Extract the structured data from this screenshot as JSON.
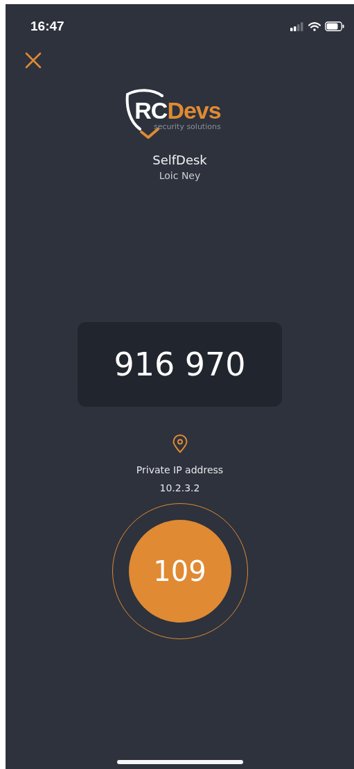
{
  "status_bar": {
    "time": "16:47"
  },
  "logo": {
    "wordmark_part_1": "RC",
    "wordmark_part_2": "Devs",
    "tagline": "security solutions"
  },
  "account": {
    "title": "SelfDesk",
    "user": "Loic Ney"
  },
  "otp": {
    "code": "916 970"
  },
  "location": {
    "label": "Private IP address",
    "ip": "10.2.3.2"
  },
  "timer": {
    "seconds": "109"
  }
}
